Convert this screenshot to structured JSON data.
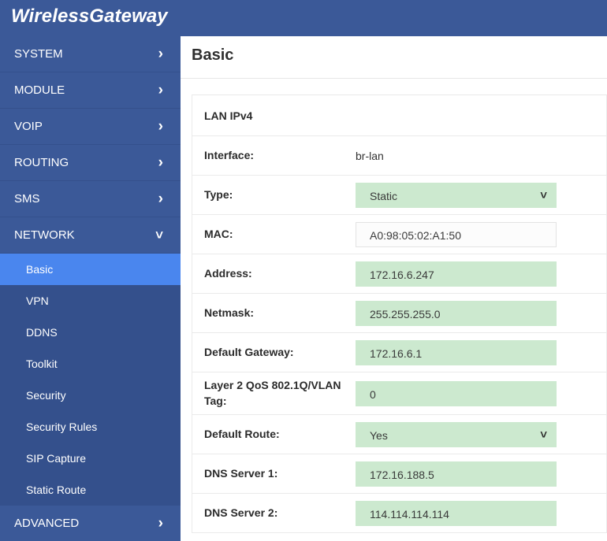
{
  "brand": {
    "name": "WirelessGateway"
  },
  "sidebar": {
    "top_items": [
      {
        "label": "SYSTEM",
        "icon": "chevron-right-icon",
        "expanded": false
      },
      {
        "label": "MODULE",
        "icon": "chevron-right-icon",
        "expanded": false
      },
      {
        "label": "VOIP",
        "icon": "chevron-right-icon",
        "expanded": false
      },
      {
        "label": "ROUTING",
        "icon": "chevron-right-icon",
        "expanded": false
      },
      {
        "label": "SMS",
        "icon": "chevron-right-icon",
        "expanded": false
      },
      {
        "label": "NETWORK",
        "icon": "chevron-down-icon",
        "expanded": true
      }
    ],
    "network_subitems": [
      {
        "label": "Basic",
        "active": true
      },
      {
        "label": "VPN",
        "active": false
      },
      {
        "label": "DDNS",
        "active": false
      },
      {
        "label": "Toolkit",
        "active": false
      },
      {
        "label": "Security",
        "active": false
      },
      {
        "label": "Security Rules",
        "active": false
      },
      {
        "label": "SIP Capture",
        "active": false
      },
      {
        "label": "Static Route",
        "active": false
      }
    ],
    "bottom_items": [
      {
        "label": "ADVANCED",
        "icon": "chevron-right-icon",
        "expanded": false
      }
    ]
  },
  "main": {
    "page_title": "Basic",
    "section_title": "LAN IPv4",
    "fields": {
      "interface": {
        "label": "Interface:",
        "value": "br-lan"
      },
      "type": {
        "label": "Type:",
        "value": "Static"
      },
      "mac": {
        "label": "MAC:",
        "value": "A0:98:05:02:A1:50"
      },
      "address": {
        "label": "Address:",
        "value": "172.16.6.247"
      },
      "netmask": {
        "label": "Netmask:",
        "value": "255.255.255.0"
      },
      "gateway": {
        "label": "Default Gateway:",
        "value": "172.16.6.1"
      },
      "vlan_tag": {
        "label": "Layer 2 QoS 802.1Q/VLAN Tag:",
        "value": "0"
      },
      "default_route": {
        "label": "Default Route:",
        "value": "Yes"
      },
      "dns1": {
        "label": "DNS Server 1:",
        "value": "172.16.188.5"
      },
      "dns2": {
        "label": "DNS Server 2:",
        "value": "114.114.114.114"
      }
    }
  },
  "colors": {
    "brand_blue": "#3b5998",
    "submenu_blue": "#34508c",
    "active_blue": "#4a86ee",
    "field_green": "#cce9cf",
    "border_gray": "#eaeaea"
  }
}
